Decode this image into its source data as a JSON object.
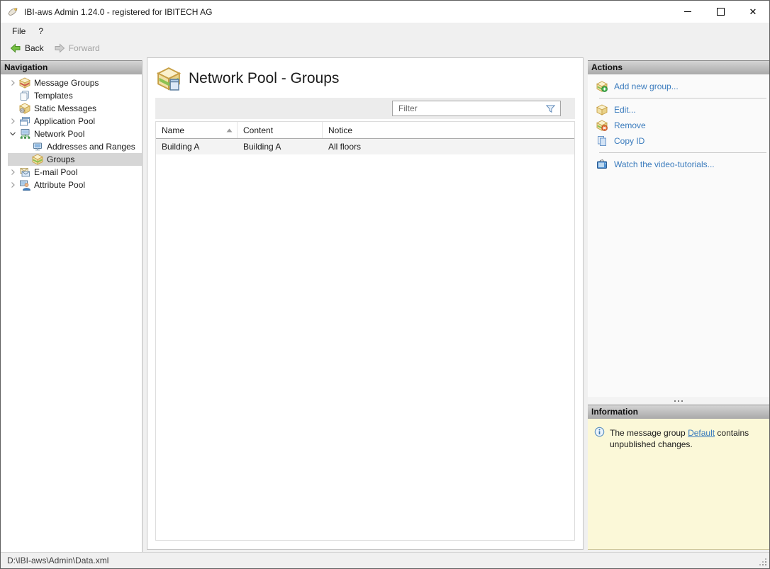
{
  "window": {
    "title": "IBI-aws Admin 1.24.0 - registered for IBITECH AG",
    "controls": [
      "minimize",
      "maximize",
      "close"
    ]
  },
  "menu": {
    "items": [
      {
        "label": "File"
      },
      {
        "label": "?"
      }
    ]
  },
  "toolbar": {
    "back_label": "Back",
    "forward_label": "Forward",
    "back_icon": "green-left-arrow-icon",
    "forward_icon": "gray-right-arrow-icon",
    "forward_disabled": true
  },
  "navigation": {
    "header": "Navigation",
    "items": [
      {
        "label": "Message Groups",
        "icon": "message-groups-box-icon",
        "state": "collapsed",
        "level": 0,
        "selected": false
      },
      {
        "label": "Templates",
        "icon": "templates-icon",
        "state": "leaf",
        "level": 0,
        "selected": false
      },
      {
        "label": "Static Messages",
        "icon": "static-messages-icon",
        "state": "leaf",
        "level": 0,
        "selected": false
      },
      {
        "label": "Application Pool",
        "icon": "application-pool-icon",
        "state": "collapsed",
        "level": 0,
        "selected": false
      },
      {
        "label": "Network Pool",
        "icon": "network-pool-icon",
        "state": "expanded",
        "level": 0,
        "selected": false
      },
      {
        "label": "Addresses and Ranges",
        "icon": "addresses-ranges-icon",
        "state": "leaf",
        "level": 1,
        "selected": false
      },
      {
        "label": "Groups",
        "icon": "groups-box-icon",
        "state": "leaf",
        "level": 1,
        "selected": true
      },
      {
        "label": "E-mail Pool",
        "icon": "email-pool-icon",
        "state": "collapsed",
        "level": 0,
        "selected": false
      },
      {
        "label": "Attribute Pool",
        "icon": "attribute-pool-icon",
        "state": "collapsed",
        "level": 0,
        "selected": false
      }
    ]
  },
  "main": {
    "title": "Network Pool - Groups",
    "title_icon": "network-pool-groups-icon",
    "filter_placeholder": "Filter",
    "filter_icon": "funnel-filter-icon",
    "table": {
      "columns": [
        "Name",
        "Content",
        "Notice"
      ],
      "sort": {
        "column": "Name",
        "direction": "ascending"
      },
      "rows": [
        [
          "Building A",
          "Building A",
          "All floors"
        ]
      ]
    }
  },
  "actions": {
    "header": "Actions",
    "items": [
      {
        "label": "Add new group...",
        "icon": "add-group-icon"
      },
      {
        "label": "Edit...",
        "icon": "edit-group-icon"
      },
      {
        "label": "Remove",
        "icon": "remove-group-icon"
      },
      {
        "label": "Copy ID",
        "icon": "copy-id-icon"
      },
      {
        "label": "Watch the video-tutorials...",
        "icon": "video-tutorials-tv-icon"
      }
    ]
  },
  "information": {
    "header": "Information",
    "icon": "info-circle-icon",
    "message_prefix": "The message group ",
    "link_text": "Default",
    "message_suffix": " contains unpublished changes."
  },
  "statusbar": {
    "path": "D:\\IBI-aws\\Admin\\Data.xml"
  },
  "colors": {
    "link_blue": "#3a7bbd",
    "selection_gray": "#d6d6d6",
    "info_panel_bg": "#fbf8d8",
    "box_stripe_red": "#cd5848",
    "box_stripe_green": "#8cc152",
    "back_arrow_green": "#76c043",
    "panel_header_top": "#d4d4d4",
    "panel_header_bottom": "#a9a9a9",
    "table_row_bg": "#f3f3f3"
  }
}
